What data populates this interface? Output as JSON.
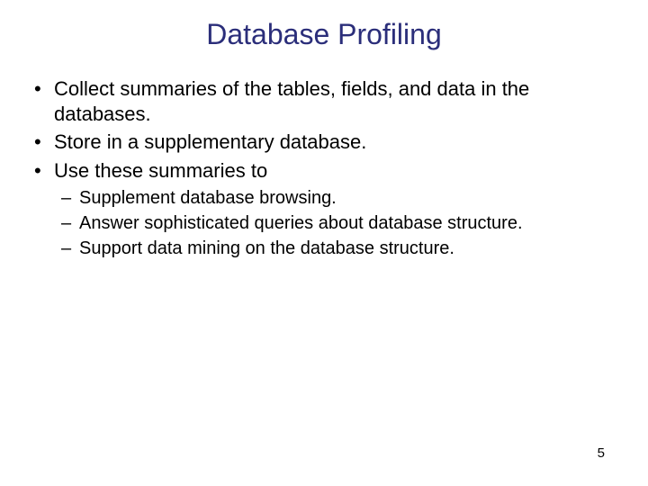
{
  "title": "Database Profiling",
  "bullets": [
    "Collect summaries of the tables, fields, and data in the databases.",
    "Store in a supplementary database.",
    "Use these summaries to"
  ],
  "sub_bullets": [
    "Supplement database browsing.",
    "Answer sophisticated queries about database structure.",
    "Support data mining on the database structure."
  ],
  "page_number": "5"
}
